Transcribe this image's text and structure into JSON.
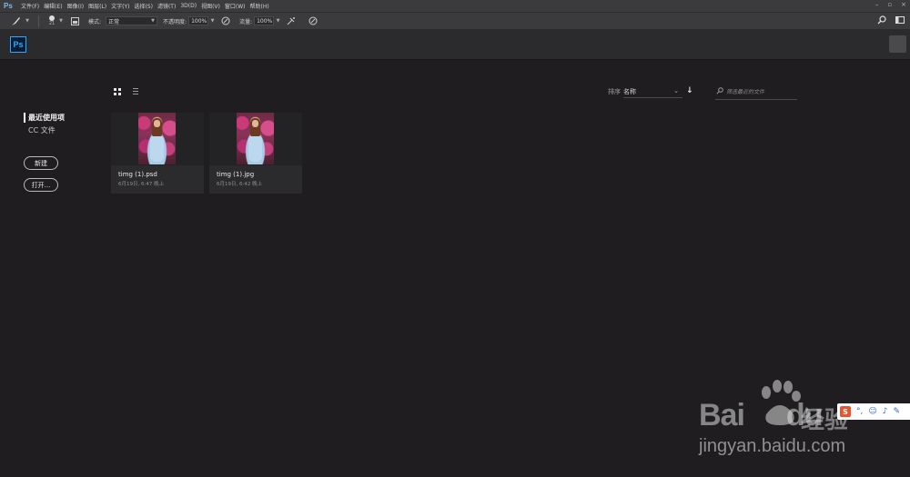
{
  "app": {
    "logo_text": "Ps"
  },
  "menubar": {
    "items": [
      "文件(F)",
      "编辑(E)",
      "图像(I)",
      "图层(L)",
      "文字(Y)",
      "选择(S)",
      "滤镜(T)",
      "3D(D)",
      "视图(V)",
      "窗口(W)",
      "帮助(H)"
    ],
    "window_controls": [
      "–",
      "▫",
      "×"
    ]
  },
  "optionsbar": {
    "brush_size": "21",
    "mode_label": "模式:",
    "mode_value": "正常",
    "opacity_label": "不透明度:",
    "opacity_value": "100%",
    "flow_label": "流量:",
    "flow_value": "100%"
  },
  "sidebar": {
    "items": [
      {
        "label": "最近使用项",
        "active": true
      },
      {
        "label": "CC 文件",
        "active": false
      }
    ],
    "new_button": "新建",
    "open_button": "打开..."
  },
  "toolbar": {
    "sort_label": "排序",
    "sort_value": "名称",
    "search_placeholder": "筛选最近的文件"
  },
  "files": [
    {
      "name": "timg (1).psd",
      "date": "6月19日, 6:47 晚上"
    },
    {
      "name": "timg (1).jpg",
      "date": "6月19日, 6:42 晚上"
    }
  ],
  "watermark": {
    "brand": "Bai",
    "brand2": "du",
    "cn": "经验",
    "url": "jingyan.baidu.com",
    "ime_logo": "S"
  },
  "colors": {
    "accent": "#31a8ff",
    "background": "#1f1d20",
    "card": "#2b2a2d"
  }
}
